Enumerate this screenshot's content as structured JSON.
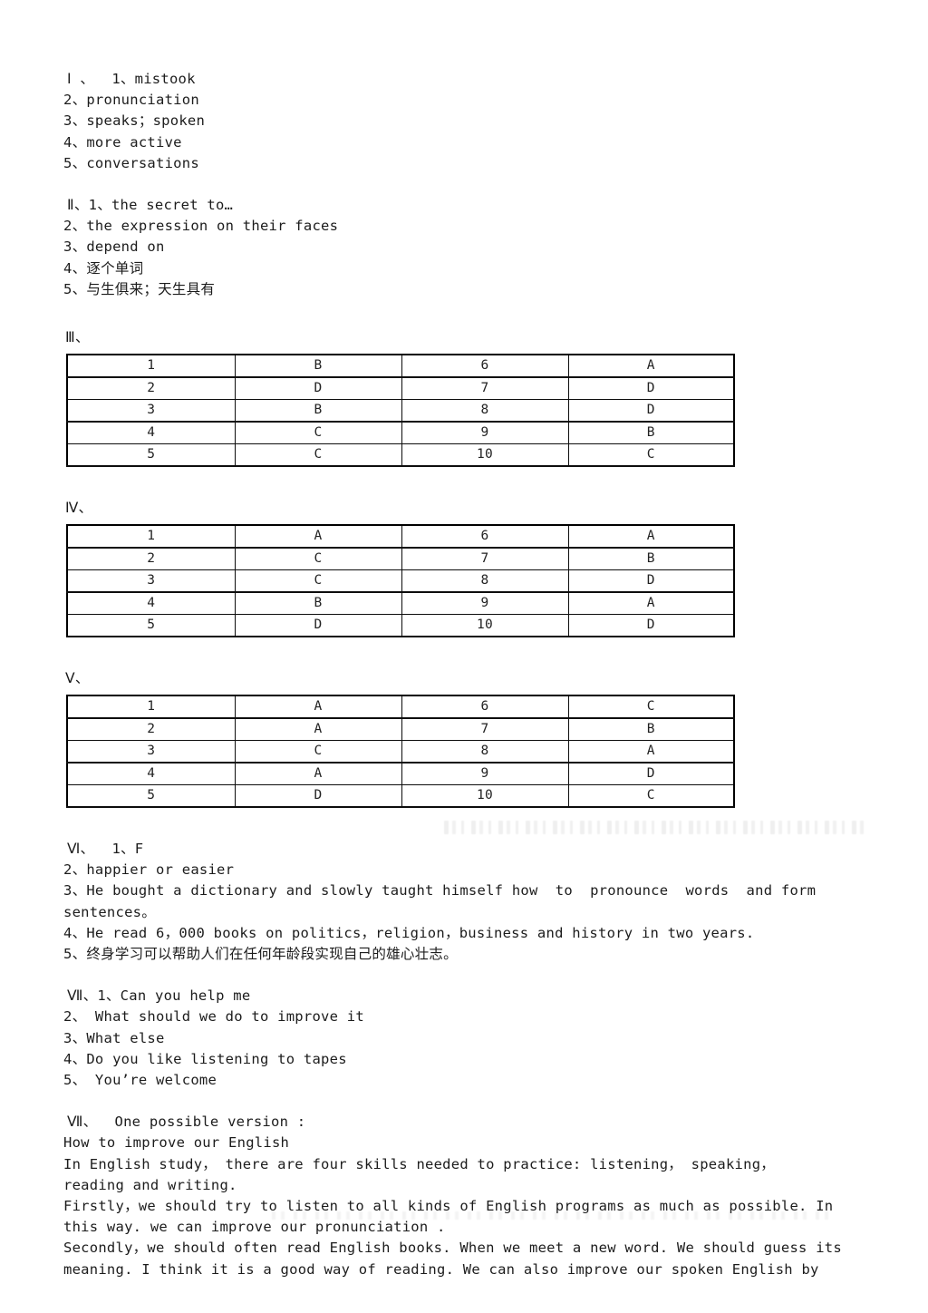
{
  "document": {
    "background": "#ffffff",
    "text_color": "#1c1c1c"
  },
  "section_1": {
    "heading_line": "Ⅰ 、  1、mistook",
    "lines": [
      "2、pronunciation",
      "3、speaks；spoken",
      "4、more active",
      "5、conversations"
    ]
  },
  "section_2": {
    "heading_line": "Ⅱ、1、the secret to…",
    "lines": [
      "2、the expression on their faces",
      "3、depend on",
      "4、逐个单词",
      "5、与生俱来；天生具有"
    ]
  },
  "section_3": {
    "heading": "Ⅲ、",
    "table": {
      "rows": [
        [
          "1",
          "B",
          "6",
          "A"
        ],
        [
          "2",
          "D",
          "7",
          "D"
        ],
        [
          "3",
          "B",
          "8",
          "D"
        ],
        [
          "4",
          "C",
          "9",
          "B"
        ],
        [
          "5",
          "C",
          "10",
          "C"
        ]
      ]
    }
  },
  "section_4": {
    "heading": "Ⅳ、",
    "table": {
      "rows": [
        [
          "1",
          "A",
          "6",
          "A"
        ],
        [
          "2",
          "C",
          "7",
          "B"
        ],
        [
          "3",
          "C",
          "8",
          "D"
        ],
        [
          "4",
          "B",
          "9",
          "A"
        ],
        [
          "5",
          "D",
          "10",
          "D"
        ]
      ]
    }
  },
  "section_5": {
    "heading": "Ⅴ、",
    "table": {
      "rows": [
        [
          "1",
          "A",
          "6",
          "C"
        ],
        [
          "2",
          "A",
          "7",
          "B"
        ],
        [
          "3",
          "C",
          "8",
          "A"
        ],
        [
          "4",
          "A",
          "9",
          "D"
        ],
        [
          "5",
          "D",
          "10",
          "C"
        ]
      ]
    }
  },
  "section_6": {
    "heading_line": "Ⅵ、  1、F",
    "lines": [
      "2、happier or easier",
      "3、He bought a dictionary and slowly taught himself how  to  pronounce  words  and form",
      "sentences。",
      "4、He read 6，000 books on politics，religion，business and history in two years.",
      "5、终身学习可以帮助人们在任何年龄段实现自己的雄心壮志。"
    ]
  },
  "section_7": {
    "heading_line": "Ⅶ、1、Can you help me",
    "lines": [
      "2、 What should we do to improve it",
      "3、What else",
      "4、Do you like listening to tapes",
      "5、 You’re welcome"
    ]
  },
  "section_8": {
    "heading_line": "Ⅶ、  One possible version :",
    "title": "How to improve our English",
    "lines": [
      "In English study， there are four skills needed to practice: listening， speaking，",
      "reading and writing.",
      "Firstly，we should try to listen to all kinds of English programs as much as possible. In",
      "this way. we can improve our pronunciation .",
      "Secondly，we should often read English books. When we meet a new word. We should guess its",
      "meaning. I think it is a good way of reading. We can also improve our spoken English by"
    ]
  }
}
